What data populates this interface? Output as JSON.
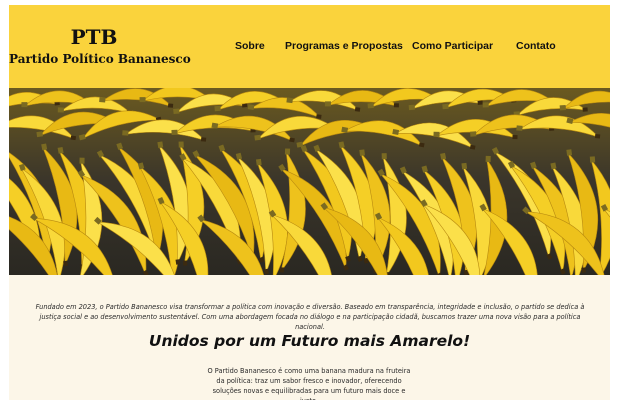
{
  "brand": {
    "abbr": "PTB",
    "name": "Partido Político Bananesco"
  },
  "nav": {
    "items": [
      {
        "label": "Sobre"
      },
      {
        "label": "Programas e Propostas"
      },
      {
        "label": "Como Participar"
      },
      {
        "label": "Contato"
      }
    ]
  },
  "hero": {
    "image": "bananas-photo"
  },
  "main": {
    "intro": "Fundado em 2023, o Partido Bananesco visa transformar a política com inovação e diversão. Baseado em transparência, integridade e inclusão, o partido se dedica à justiça social e ao desenvolvimento sustentável. Com uma abordagem focada no diálogo e na participação cidadã, buscamos trazer uma nova visão para a política nacional.",
    "headline": "Unidos por um Futuro mais Amarelo!",
    "tagline": "O Partido Bananesco é como uma banana madura na fruteira da política: traz um sabor fresco e inovador, oferecendo soluções novas e equilibradas para um futuro mais doce e justo."
  },
  "colors": {
    "header_bg": "#fad33c",
    "content_bg": "#fcf6e8",
    "banana": "#f2c81e"
  }
}
